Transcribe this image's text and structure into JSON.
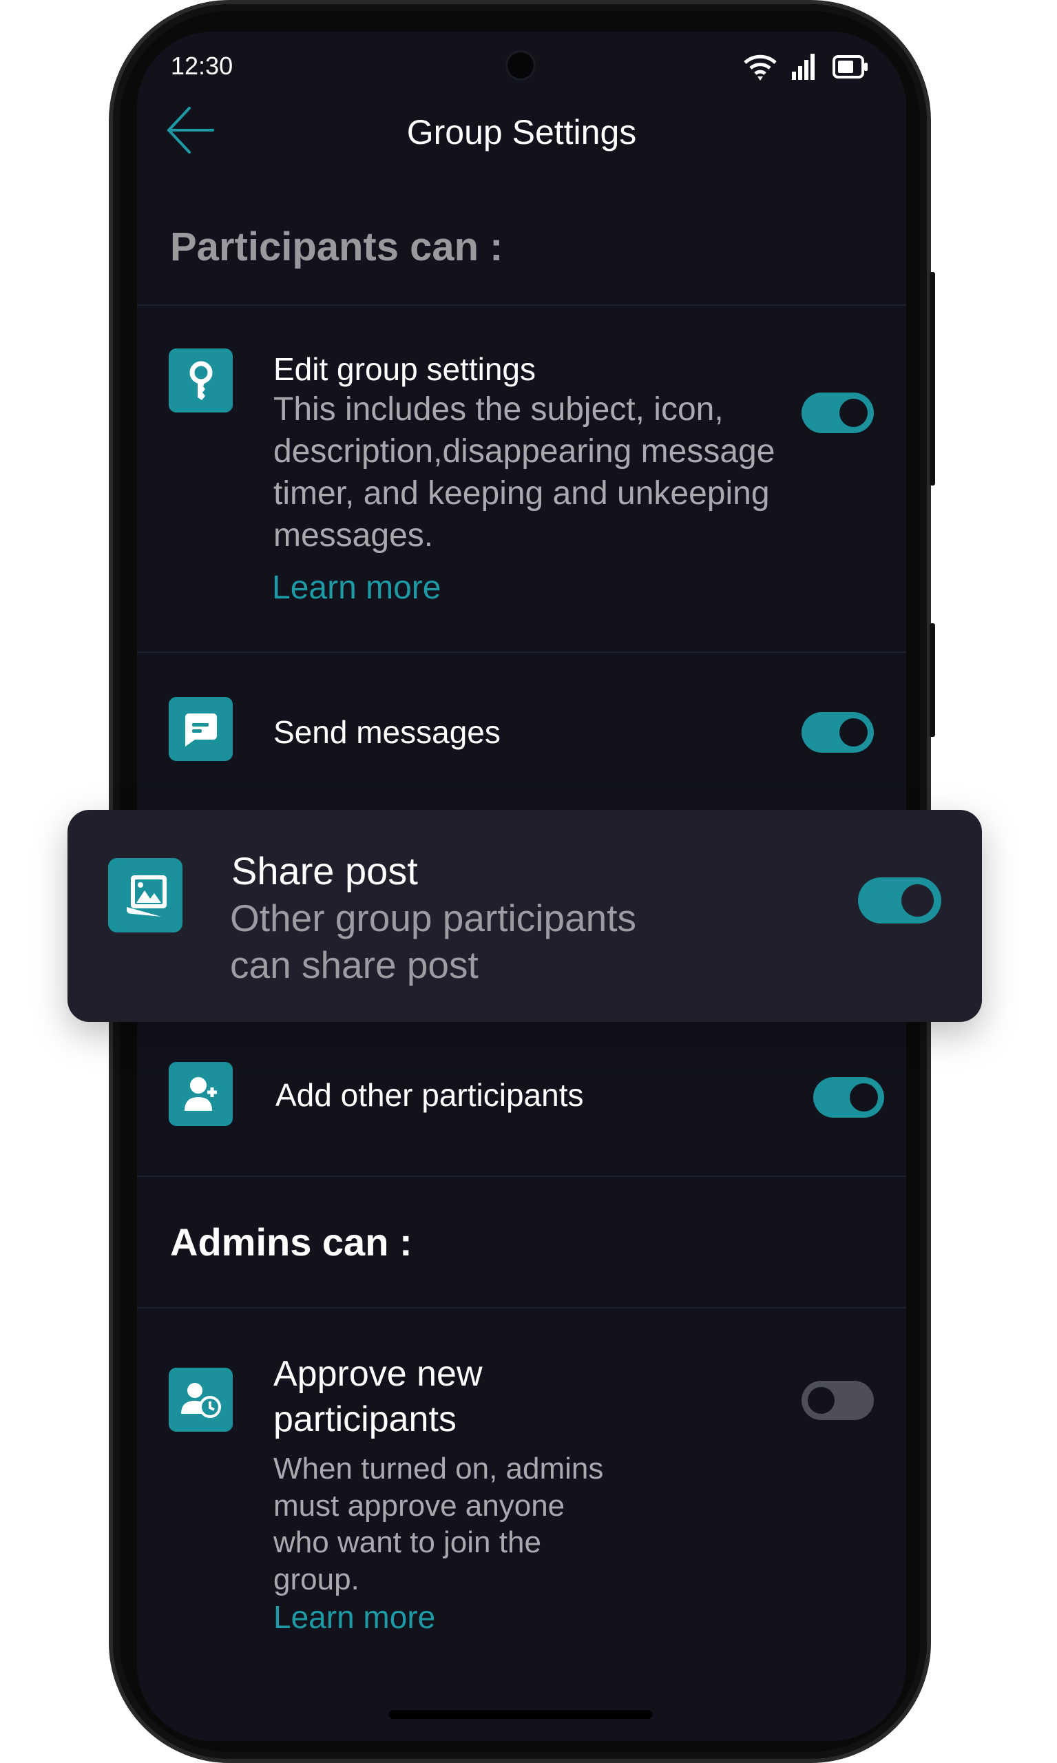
{
  "status_bar": {
    "time": "12:30",
    "icons": [
      "wifi-icon",
      "signal-icon",
      "battery-icon"
    ]
  },
  "header": {
    "title": "Group Settings",
    "back_icon": "arrow-left-icon"
  },
  "colors": {
    "accent": "#1a919b",
    "link": "#1e9aa5",
    "background": "#11121c",
    "card": "#1f202b"
  },
  "participants_section": {
    "heading": "Participants can :",
    "items": [
      {
        "title": "Edit group settings",
        "description": "This includes the subject, icon, description,disappearing message timer, and keeping and unkeeping messages.",
        "link": "Learn more",
        "icon": "key-icon",
        "enabled": true
      },
      {
        "title": "Send messages",
        "icon": "message-icon",
        "enabled": true
      },
      {
        "title": "Share post",
        "description_line1": "Other group participants",
        "description_line2": "can share post",
        "icon": "image-icon",
        "enabled": true
      },
      {
        "title": "Add other participants",
        "icon": "add-user-icon",
        "enabled": true
      }
    ]
  },
  "admins_section": {
    "heading": "Admins can :",
    "items": [
      {
        "title_line1": "Approve new",
        "title_line2": "participants",
        "description_lines": [
          "When turned on, admins",
          "must approve anyone",
          "who want to join the",
          "group."
        ],
        "link": "Learn more",
        "icon": "user-clock-icon",
        "enabled": false
      }
    ]
  }
}
